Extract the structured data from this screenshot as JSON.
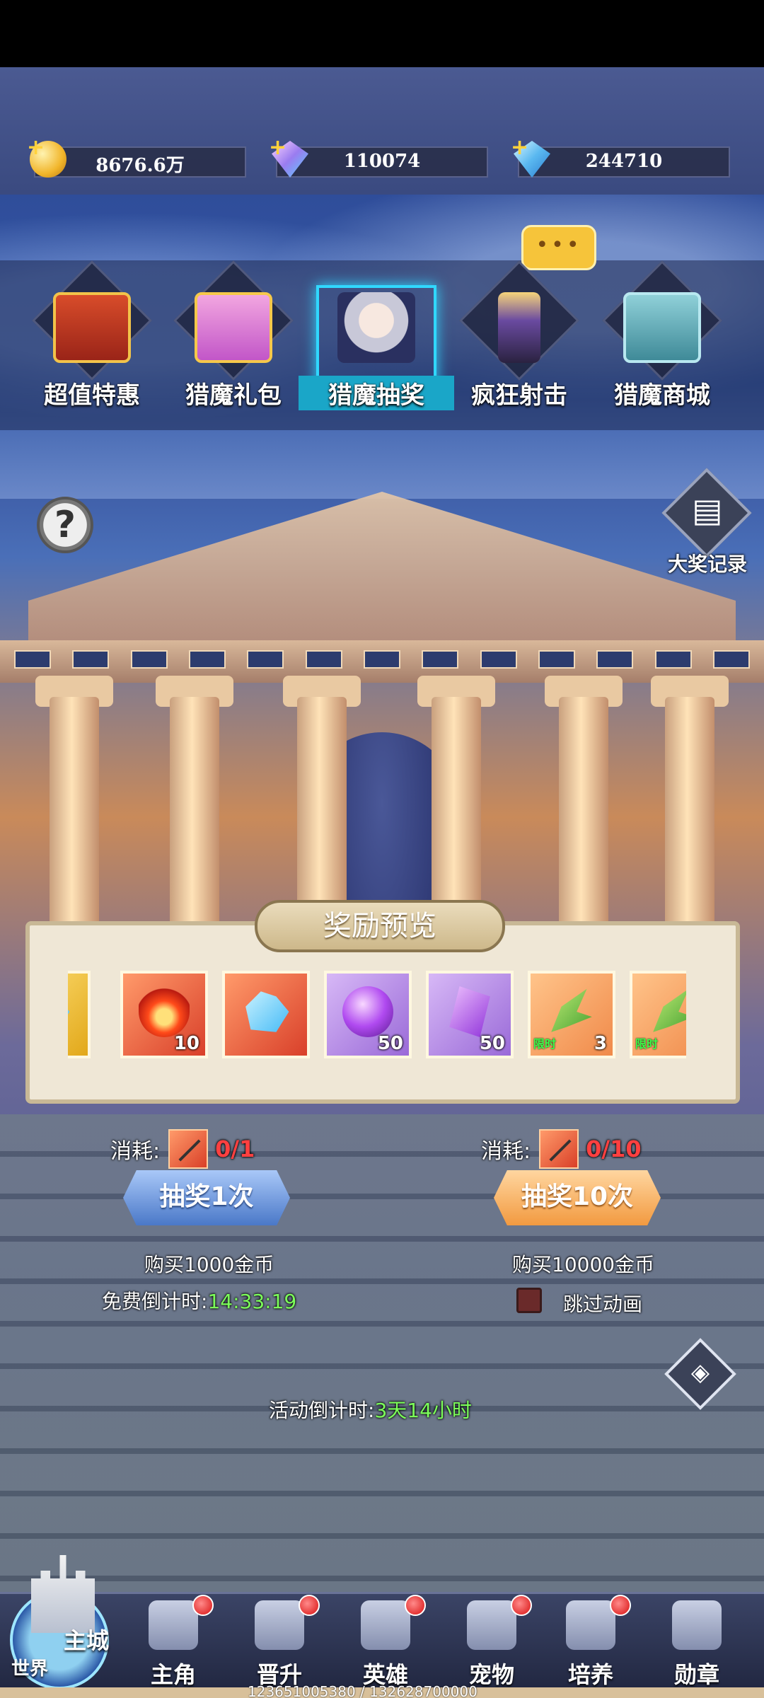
{
  "currency": [
    {
      "icon": "gold-coin-icon",
      "value": "8676.6万"
    },
    {
      "icon": "pink-diamond-icon",
      "value": "110074"
    },
    {
      "icon": "blue-diamond-icon",
      "value": "244710"
    }
  ],
  "tabs": [
    {
      "label": "超值特惠",
      "icon": "treasure-chest-icon",
      "active": false
    },
    {
      "label": "猎魔礼包",
      "icon": "gift-box-icon",
      "active": false
    },
    {
      "label": "猎魔抽奖",
      "icon": "hero-portrait-icon",
      "active": true
    },
    {
      "label": "疯狂射击",
      "icon": "bullet-tower-icon",
      "active": false
    },
    {
      "label": "猎魔商城",
      "icon": "shop-chest-icon",
      "active": false
    }
  ],
  "side": {
    "help": "?",
    "record_label": "大奖记录"
  },
  "rewards": {
    "title": "奖励预览",
    "items": [
      {
        "icon": "diamond-icon",
        "count": "",
        "tag": ""
      },
      {
        "icon": "fire-essence-icon",
        "count": "10",
        "tag": ""
      },
      {
        "icon": "blue-crystal-icon",
        "count": "",
        "tag": ""
      },
      {
        "icon": "purple-orb-icon",
        "count": "50",
        "tag": ""
      },
      {
        "icon": "purple-shard-icon",
        "count": "50",
        "tag": ""
      },
      {
        "icon": "laurel-leaf-icon",
        "count": "3",
        "tag": "限时"
      },
      {
        "icon": "laurel-leaf-icon",
        "count": "",
        "tag": "限时"
      }
    ]
  },
  "draw": {
    "cost_label": "消耗:",
    "single": {
      "cost": "0/1",
      "button": "抽奖1次",
      "bonus": "购买1000金币"
    },
    "ten": {
      "cost": "0/10",
      "button": "抽奖10次",
      "bonus": "购买10000金币"
    },
    "free_label": "免费倒计时:",
    "free_time": "14:33:19",
    "skip_label": "跳过动画",
    "event_label": "活动倒计时:",
    "event_time": "3天14小时"
  },
  "nav": {
    "home_label": "主城",
    "world_label": "世界",
    "items": [
      {
        "label": "主角",
        "icon": "hero-icon"
      },
      {
        "label": "晋升",
        "icon": "promote-icon"
      },
      {
        "label": "英雄",
        "icon": "helmet-icon"
      },
      {
        "label": "宠物",
        "icon": "pet-icon"
      },
      {
        "label": "培养",
        "icon": "train-icon"
      },
      {
        "label": "勋章",
        "icon": "medal-icon"
      }
    ]
  },
  "debug_text": "123651005380 / 132628700000"
}
